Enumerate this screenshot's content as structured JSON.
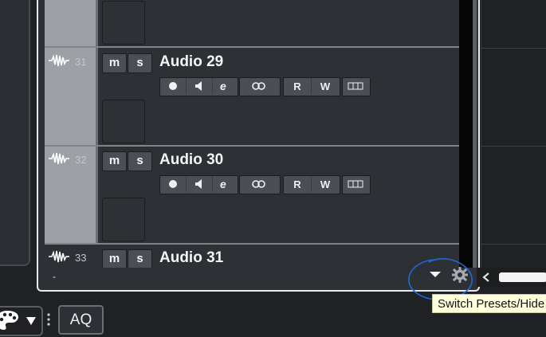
{
  "tracks": [
    {
      "number": "31",
      "name": "Audio 29",
      "mute_label": "m",
      "solo_label": "s",
      "read_label": "R",
      "write_label": "W"
    },
    {
      "number": "32",
      "name": "Audio 30",
      "mute_label": "m",
      "solo_label": "s",
      "read_label": "R",
      "write_label": "W"
    },
    {
      "number": "33",
      "name": "Audio 31",
      "mute_label": "m",
      "solo_label": "s"
    }
  ],
  "footer": {
    "dash": "-"
  },
  "tooltip": {
    "text": "Switch Presets/Hide"
  },
  "toolbar": {
    "aq_label": "AQ"
  },
  "icons": {
    "waveform": "audio-waveform-icon",
    "record": "record-enable-icon",
    "monitor": "speaker-monitor-icon",
    "edit": "edit-channel-icon",
    "link": "link-icon",
    "lanes": "lanes-icon",
    "dropdown": "dropdown-arrow-icon",
    "gear": "gear-icon",
    "palette": "palette-icon"
  },
  "colors": {
    "tooltip_bg": "#ffffdc",
    "annotation": "#1e6bd6",
    "track_strip": "#9da1a6"
  }
}
